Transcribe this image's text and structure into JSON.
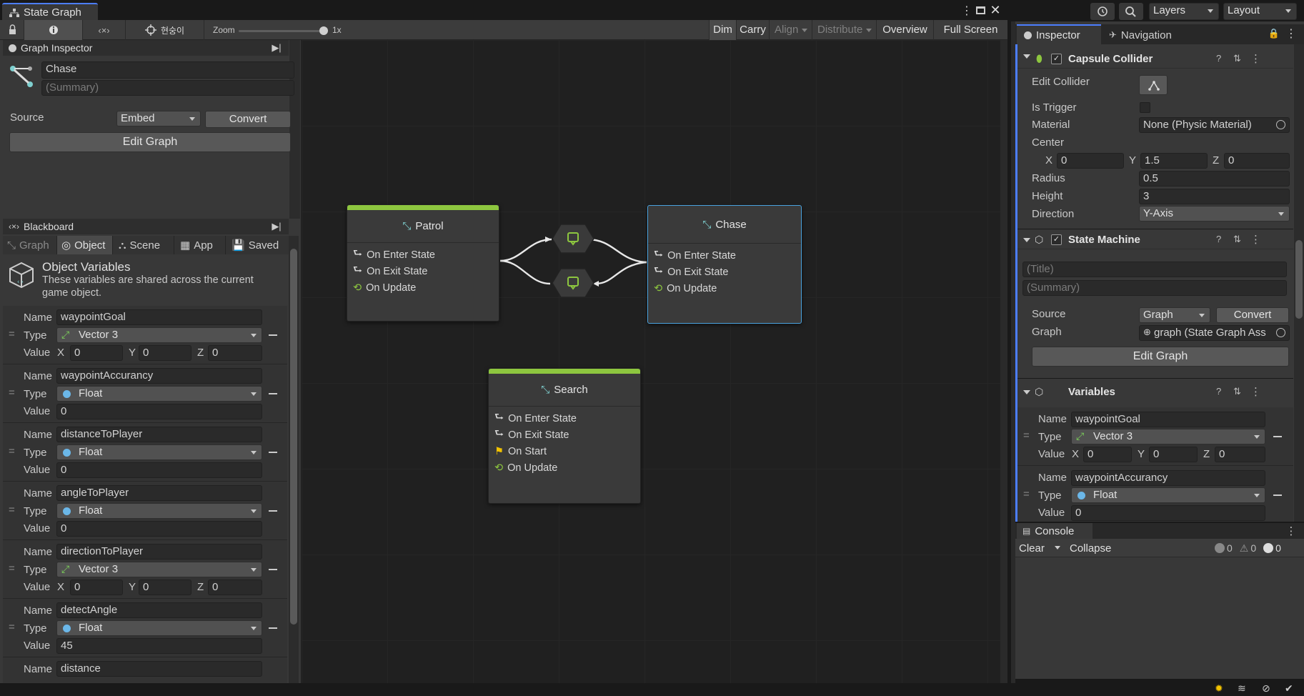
{
  "window": {
    "title": "State Graph"
  },
  "toolbar": {
    "object_name": "현숭이",
    "zoom_label": "Zoom",
    "zoom_value": "1x",
    "buttons": [
      "Dim",
      "Carry",
      "Align",
      "Distribute",
      "Overview",
      "Full Screen"
    ]
  },
  "graph_inspector": {
    "header": "Graph Inspector",
    "title": "Chase",
    "summary_placeholder": "(Summary)",
    "source_label": "Source",
    "source_value": "Embed",
    "convert_label": "Convert",
    "edit_graph_label": "Edit Graph"
  },
  "blackboard": {
    "header": "Blackboard",
    "tabs": [
      "Graph",
      "Object",
      "Scene",
      "App",
      "Saved"
    ],
    "section_title": "Object Variables",
    "section_desc_1": "These variables are shared across the current",
    "section_desc_2": "game object.",
    "labels": {
      "name": "Name",
      "type": "Type",
      "value": "Value",
      "x": "X",
      "y": "Y",
      "z": "Z"
    },
    "variables": [
      {
        "name": "waypointGoal",
        "type": "Vector 3",
        "x": "0",
        "y": "0",
        "z": "0"
      },
      {
        "name": "waypointAccurancy",
        "type": "Float",
        "value": "0"
      },
      {
        "name": "distanceToPlayer",
        "type": "Float",
        "value": "0"
      },
      {
        "name": "angleToPlayer",
        "type": "Float",
        "value": "0"
      },
      {
        "name": "directionToPlayer",
        "type": "Vector 3",
        "x": "0",
        "y": "0",
        "z": "0"
      },
      {
        "name": "detectAngle",
        "type": "Float",
        "value": "45"
      },
      {
        "name": "distance"
      }
    ]
  },
  "graph": {
    "nodes": {
      "patrol": {
        "title": "Patrol",
        "rows": [
          "On Enter State",
          "On Exit State",
          "On Update"
        ]
      },
      "chase": {
        "title": "Chase",
        "rows": [
          "On Enter State",
          "On Exit State",
          "On Update"
        ]
      },
      "search": {
        "title": "Search",
        "rows": [
          "On Enter State",
          "On Exit State",
          "On Start",
          "On Update"
        ]
      }
    }
  },
  "top_right": {
    "layers": "Layers",
    "layout": "Layout"
  },
  "inspector": {
    "tabs": [
      "Inspector",
      "Navigation"
    ],
    "capsule_collider": {
      "title": "Capsule Collider",
      "edit_collider": "Edit Collider",
      "is_trigger": "Is Trigger",
      "material_label": "Material",
      "material_value": "None (Physic Material)",
      "center_label": "Center",
      "center": {
        "x": "0",
        "y": "1.5",
        "z": "0"
      },
      "radius_label": "Radius",
      "radius": "0.5",
      "height_label": "Height",
      "height": "3",
      "direction_label": "Direction",
      "direction": "Y-Axis"
    },
    "state_machine": {
      "title": "State Machine",
      "title_placeholder": "(Title)",
      "summary_placeholder": "(Summary)",
      "source_label": "Source",
      "source_value": "Graph",
      "convert_label": "Convert",
      "graph_label": "Graph",
      "graph_value": "graph (State Graph Ass",
      "edit_graph_label": "Edit Graph"
    },
    "variables": {
      "title": "Variables",
      "items": [
        {
          "name": "waypointGoal",
          "type": "Vector 3",
          "x": "0",
          "y": "0",
          "z": "0"
        },
        {
          "name": "waypointAccurancy",
          "type": "Float",
          "value": "0"
        }
      ]
    }
  },
  "console": {
    "tab": "Console",
    "clear": "Clear",
    "collapse": "Collapse",
    "counts": [
      "0",
      "0",
      "0"
    ]
  },
  "colors": {
    "accent_green": "#8dc63f",
    "selection_blue": "#4aa3df",
    "float_dot": "#6bb7e8"
  }
}
